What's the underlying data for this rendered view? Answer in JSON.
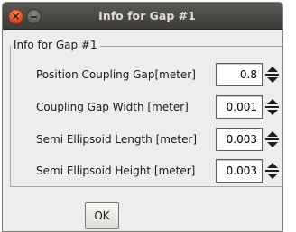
{
  "window": {
    "title": "Info for Gap #1",
    "buttons": {
      "close_glyph": "×"
    }
  },
  "group": {
    "legend": "Info for Gap #1",
    "fields": [
      {
        "label": "Position Coupling Gap[meter]",
        "value": "0.8"
      },
      {
        "label": "Coupling Gap Width [meter]",
        "value": "0.001"
      },
      {
        "label": "Semi Ellipsoid Length [meter]",
        "value": "0.003"
      },
      {
        "label": "Semi Ellipsoid Height [meter]",
        "value": "0.003"
      }
    ]
  },
  "footer": {
    "ok_label": "OK"
  },
  "colors": {
    "titlebar": "#3d3c38",
    "close_button": "#e3542a",
    "window_bg": "#ededeb"
  }
}
